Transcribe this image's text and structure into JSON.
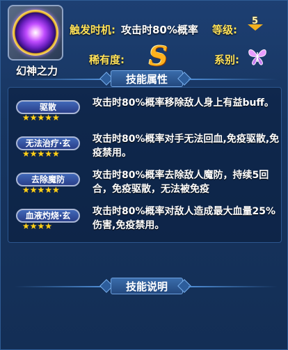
{
  "skill": {
    "name": "幻神之力",
    "trigger_label": "触发时机:",
    "trigger_value": "攻击时80%概率",
    "level_label": "等级:",
    "level_value": "5",
    "rarity_label": "稀有度:",
    "rarity_grade": "S",
    "element_label": "系别:",
    "element_icon": "butterfly-icon",
    "icon": "violet-orb-icon"
  },
  "sections": {
    "attributes_title": "技能属性",
    "description_title": "技能说明"
  },
  "effects": [
    {
      "tag": "驱散",
      "stars": "★★★★★",
      "description": "攻击时80%概率移除敌人身上有益buff。"
    },
    {
      "tag": "无法治疗·玄",
      "stars": "★★★★★",
      "description": "攻击时80%概率对手无法回血,免疫驱散,免疫禁用。"
    },
    {
      "tag": "去除魔防",
      "stars": "★★★★★",
      "description": "攻击时80%概率去除敌人魔防，持续5回合，免疫驱散，无法被免疫"
    },
    {
      "tag": "血液灼烧·玄",
      "stars": "★★★★",
      "description": "攻击时80%概率对敌人造成最大血量25%伤害,免疫禁用。"
    }
  ],
  "colors": {
    "label_yellow": "#ffe25a",
    "star_gold": "#ffd21a",
    "panel_blue": "#173560",
    "grade_orange": "#ffb21e",
    "butterfly_pink": "#e89cff"
  }
}
